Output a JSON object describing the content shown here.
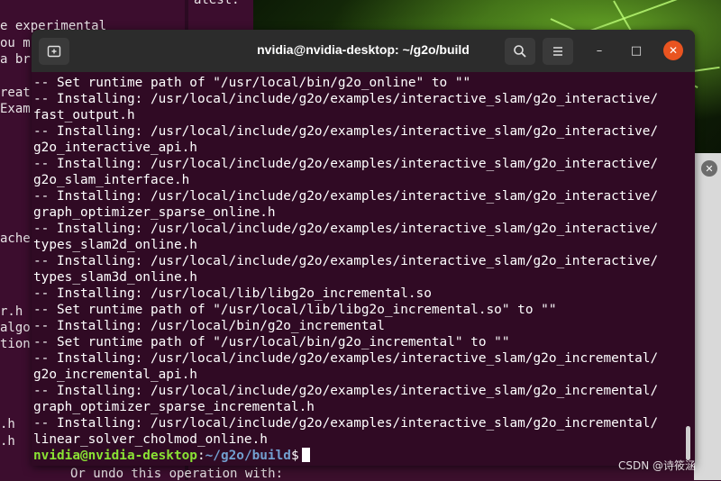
{
  "background": {
    "left_fragments": [
      "e experimental",
      "ou m",
      "a br",
      "reat",
      "Exam",
      "ache",
      "r.h",
      "algo",
      "tion",
      ".h",
      ".h"
    ],
    "mid_fragment": "atest.",
    "bottom_text": "Or undo this operation with:",
    "watermark": "CSDN @诗筱涵"
  },
  "terminal": {
    "title": "nvidia@nvidia-desktop: ~/g2o/build",
    "new_tab_icon": "new-tab-icon",
    "search_icon": "search-icon",
    "menu_icon": "hamburger-menu-icon",
    "minimize_label": "–",
    "maximize_label": "□",
    "close_label": "✕",
    "lines": [
      "-- Set runtime path of \"/usr/local/bin/g2o_online\" to \"\"",
      "-- Installing: /usr/local/include/g2o/examples/interactive_slam/g2o_interactive/",
      "fast_output.h",
      "-- Installing: /usr/local/include/g2o/examples/interactive_slam/g2o_interactive/",
      "g2o_interactive_api.h",
      "-- Installing: /usr/local/include/g2o/examples/interactive_slam/g2o_interactive/",
      "g2o_slam_interface.h",
      "-- Installing: /usr/local/include/g2o/examples/interactive_slam/g2o_interactive/",
      "graph_optimizer_sparse_online.h",
      "-- Installing: /usr/local/include/g2o/examples/interactive_slam/g2o_interactive/",
      "types_slam2d_online.h",
      "-- Installing: /usr/local/include/g2o/examples/interactive_slam/g2o_interactive/",
      "types_slam3d_online.h",
      "-- Installing: /usr/local/lib/libg2o_incremental.so",
      "-- Set runtime path of \"/usr/local/lib/libg2o_incremental.so\" to \"\"",
      "-- Installing: /usr/local/bin/g2o_incremental",
      "-- Set runtime path of \"/usr/local/bin/g2o_incremental\" to \"\"",
      "-- Installing: /usr/local/include/g2o/examples/interactive_slam/g2o_incremental/",
      "g2o_incremental_api.h",
      "-- Installing: /usr/local/include/g2o/examples/interactive_slam/g2o_incremental/",
      "graph_optimizer_sparse_incremental.h",
      "-- Installing: /usr/local/include/g2o/examples/interactive_slam/g2o_incremental/",
      "linear_solver_cholmod_online.h"
    ],
    "prompt_user": "nvidia@nvidia-desktop",
    "prompt_sep": ":",
    "prompt_path": "~/g2o/build",
    "prompt_symbol": "$"
  },
  "colors": {
    "terminal_bg": "#300a24",
    "titlebar_bg": "#2c2c2c",
    "prompt_user": "#8ae234",
    "prompt_path": "#729fcf",
    "close_button": "#e95420"
  }
}
